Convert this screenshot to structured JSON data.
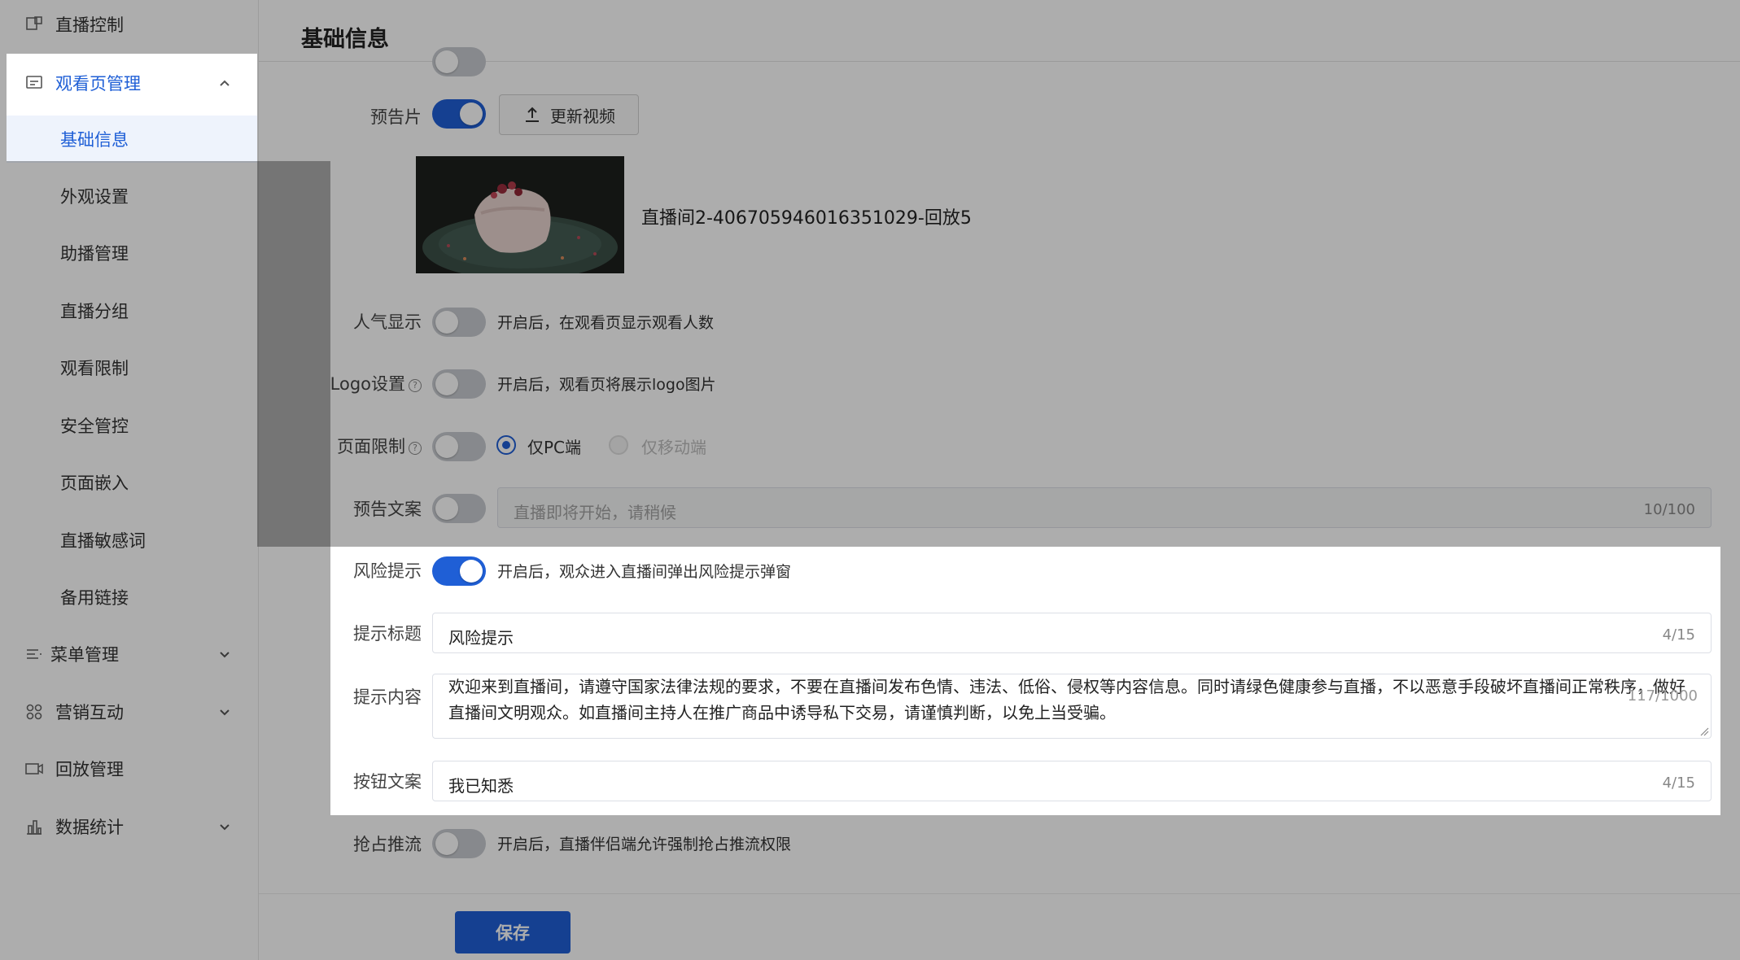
{
  "page_title": "基础信息",
  "sidebar": {
    "items": [
      {
        "label": "直播控制",
        "icon": "monitor-icon"
      },
      {
        "label": "观看页管理",
        "icon": "page-icon"
      },
      {
        "label": "菜单管理",
        "icon": "menu-list-icon"
      },
      {
        "label": "营销互动",
        "icon": "grid-icon"
      },
      {
        "label": "回放管理",
        "icon": "video-camera-icon"
      },
      {
        "label": "数据统计",
        "icon": "bar-chart-icon"
      }
    ],
    "sub_items": [
      "基础信息",
      "外观设置",
      "助播管理",
      "直播分组",
      "观看限制",
      "安全管控",
      "页面嵌入",
      "直播敏感词",
      "备用链接"
    ]
  },
  "form": {
    "trailer": {
      "label": "预告片",
      "enabled": true,
      "upload_button": "更新视频",
      "video_name": "直播间2-406705946016351029-回放5"
    },
    "popularity": {
      "label": "人气显示",
      "enabled": false,
      "hint": "开启后，在观看页显示观看人数"
    },
    "logo": {
      "label": "Logo设置",
      "enabled": false,
      "hint": "开启后，观看页将展示logo图片",
      "help": "?"
    },
    "page_limit": {
      "label": "页面限制",
      "enabled": false,
      "help": "?",
      "option_pc": "仅PC端",
      "option_mobile": "仅移动端",
      "selected": "仅PC端"
    },
    "preview_text": {
      "label": "预告文案",
      "enabled": false,
      "placeholder": "直播即将开始，请稍候",
      "count": "10/100"
    },
    "risk": {
      "label": "风险提示",
      "enabled": true,
      "hint": "开启后，观众进入直播间弹出风险提示弹窗"
    },
    "risk_title": {
      "label": "提示标题",
      "value": "风险提示",
      "count": "4/15"
    },
    "risk_content": {
      "label": "提示内容",
      "value": "欢迎来到直播间，请遵守国家法律法规的要求，不要在直播间发布色情、违法、低俗、侵权等内容信息。同时请绿色健康参与直播，不以恶意手段破坏直播间正常秩序，做好直播间文明观众。如直播间主持人在推广商品中诱导私下交易，请谨慎判断，以免上当受骗。",
      "count": "117/1000"
    },
    "button_text": {
      "label": "按钮文案",
      "value": "我已知悉",
      "count": "4/15"
    },
    "preempt": {
      "label": "抢占推流",
      "enabled": false,
      "hint": "开启后，直播伴侣端允许强制抢占推流权限"
    }
  },
  "footer": {
    "save_label": "保存"
  },
  "colors": {
    "accent": "#1f5fd6",
    "toggle_off": "#c8cbd0"
  }
}
